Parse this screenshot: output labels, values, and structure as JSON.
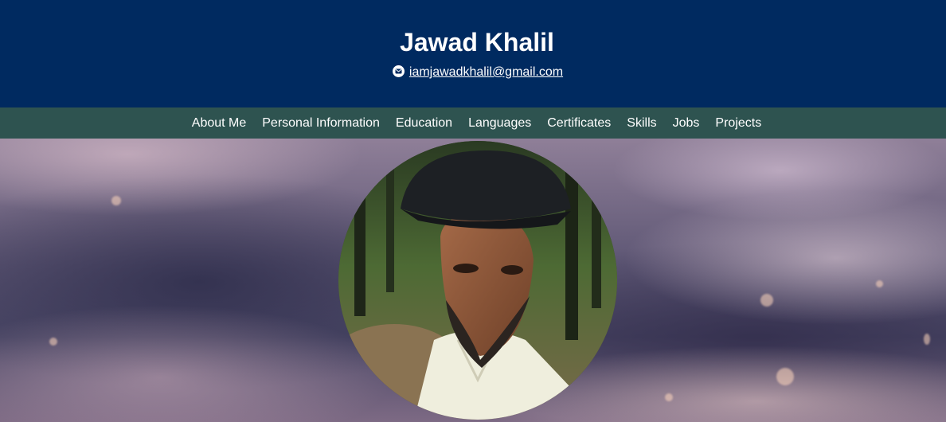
{
  "header": {
    "name": "Jawad Khalil",
    "email": "iamjawadkhalil@gmail.com",
    "email_icon": "envelope-icon"
  },
  "nav": {
    "items": [
      {
        "label": "About Me"
      },
      {
        "label": "Personal Information"
      },
      {
        "label": "Education"
      },
      {
        "label": "Languages"
      },
      {
        "label": "Certificates"
      },
      {
        "label": "Skills"
      },
      {
        "label": "Jobs"
      },
      {
        "label": "Projects"
      }
    ]
  },
  "colors": {
    "header_bg": "#002a60",
    "nav_bg": "#2e5350",
    "text": "#ffffff"
  }
}
